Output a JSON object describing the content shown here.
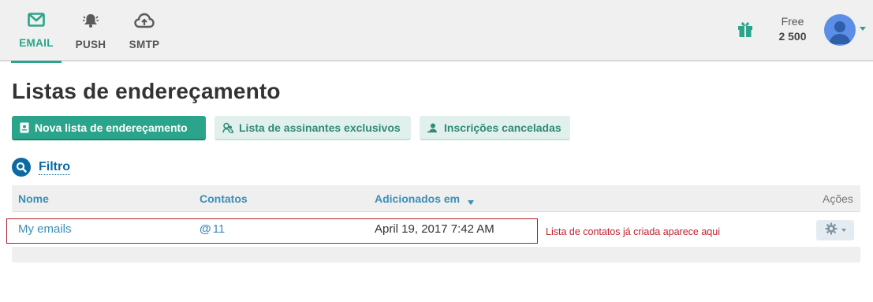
{
  "nav": {
    "tabs": [
      {
        "label": "EMAIL",
        "icon": "envelope-icon",
        "active": true
      },
      {
        "label": "PUSH",
        "icon": "bell-icon",
        "active": false
      },
      {
        "label": "SMTP",
        "icon": "cloud-upload-icon",
        "active": false
      }
    ],
    "plan_label": "Free",
    "plan_credits": "2 500",
    "gift_icon": "gift-icon",
    "avatar_icon": "user-avatar-icon"
  },
  "page": {
    "title": "Listas de endereçamento"
  },
  "actions": {
    "new_list": "Nova lista de endereçamento",
    "exclusive_list": "Lista de assinantes exclusivos",
    "unsubscribed": "Inscrições canceladas"
  },
  "filter": {
    "label": "Filtro",
    "icon": "search-icon"
  },
  "table": {
    "headers": {
      "name": "Nome",
      "contacts": "Contatos",
      "added": "Adicionados em",
      "actions": "Ações"
    },
    "sort": {
      "column": "added",
      "direction": "desc"
    },
    "rows": [
      {
        "name": "My emails",
        "contacts": "11",
        "added": "April 19, 2017 7:42 AM"
      }
    ]
  },
  "annotation": {
    "text": "Lista de contatos já criada aparece aqui",
    "color": "#c0202c"
  },
  "colors": {
    "accent": "#2aa58b",
    "link": "#3a8fb7",
    "filter_blue": "#0b6aa2"
  }
}
